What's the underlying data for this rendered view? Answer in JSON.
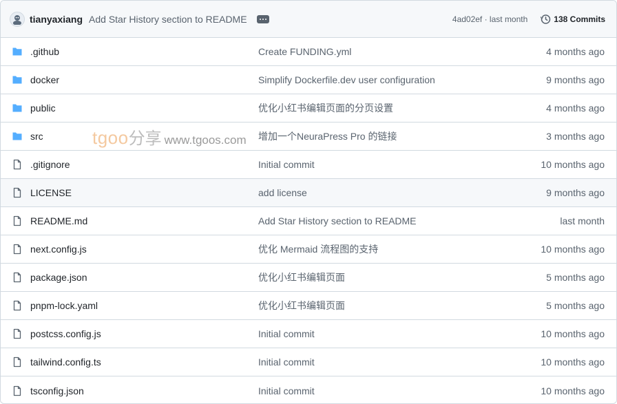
{
  "header": {
    "author": "tianyaxiang",
    "commit_message": "Add Star History section to README",
    "sha_and_time": "4ad02ef · last month",
    "commits_label": "138 Commits"
  },
  "files": [
    {
      "type": "folder",
      "name": ".github",
      "message": "Create FUNDING.yml",
      "date": "4 months ago"
    },
    {
      "type": "folder",
      "name": "docker",
      "message": "Simplify Dockerfile.dev user configuration",
      "date": "9 months ago"
    },
    {
      "type": "folder",
      "name": "public",
      "message": "优化小红书编辑页面的分页设置",
      "date": "4 months ago"
    },
    {
      "type": "folder",
      "name": "src",
      "message": "增加一个NeuraPress Pro 的链接",
      "date": "3 months ago"
    },
    {
      "type": "file",
      "name": ".gitignore",
      "message": "Initial commit",
      "date": "10 months ago"
    },
    {
      "type": "file",
      "name": "LICENSE",
      "message": "add license",
      "date": "9 months ago"
    },
    {
      "type": "file",
      "name": "README.md",
      "message": "Add Star History section to README",
      "date": "last month"
    },
    {
      "type": "file",
      "name": "next.config.js",
      "message": "优化 Mermaid 流程图的支持",
      "date": "10 months ago"
    },
    {
      "type": "file",
      "name": "package.json",
      "message": "优化小红书编辑页面",
      "date": "5 months ago"
    },
    {
      "type": "file",
      "name": "pnpm-lock.yaml",
      "message": "优化小红书编辑页面",
      "date": "5 months ago"
    },
    {
      "type": "file",
      "name": "postcss.config.js",
      "message": "Initial commit",
      "date": "10 months ago"
    },
    {
      "type": "file",
      "name": "tailwind.config.ts",
      "message": "Initial commit",
      "date": "10 months ago"
    },
    {
      "type": "file",
      "name": "tsconfig.json",
      "message": "Initial commit",
      "date": "10 months ago"
    }
  ],
  "watermark": {
    "brand": "tgoo",
    "cn": "分享",
    "url": "www.tgoos.com"
  },
  "colors": {
    "folder": "#54aeff",
    "file_icon": "#59636e",
    "border": "#d1d9e0",
    "header_bg": "#f6f8fa"
  }
}
